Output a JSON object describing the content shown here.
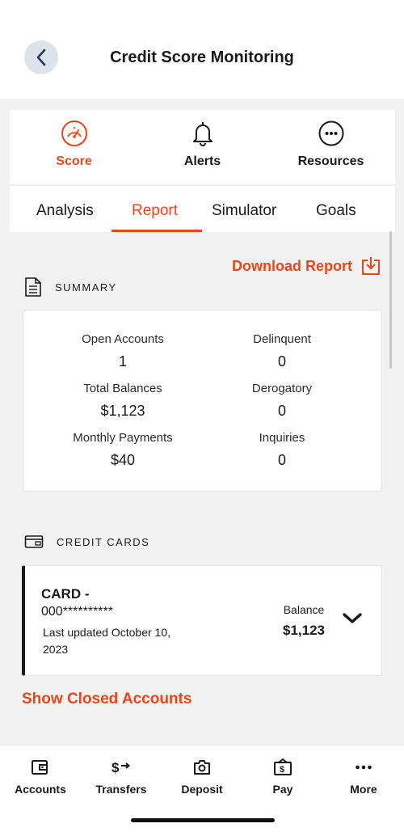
{
  "header": {
    "title": "Credit Score Monitoring",
    "back_icon": "chevron-left-icon"
  },
  "top_tabs": [
    {
      "label": "Score",
      "icon": "speedometer-icon",
      "active": true
    },
    {
      "label": "Alerts",
      "icon": "bell-icon",
      "active": false
    },
    {
      "label": "Resources",
      "icon": "more-circle-icon",
      "active": false
    }
  ],
  "sub_tabs": [
    {
      "label": "Analysis",
      "active": false
    },
    {
      "label": "Report",
      "active": true
    },
    {
      "label": "Simulator",
      "active": false
    },
    {
      "label": "Goals",
      "active": false
    }
  ],
  "download": {
    "label": "Download Report",
    "icon": "download-icon"
  },
  "summary": {
    "heading": "SUMMARY",
    "stats": [
      {
        "label": "Open Accounts",
        "value": "1"
      },
      {
        "label": "Delinquent",
        "value": "0"
      },
      {
        "label": "Total Balances",
        "value": "$1,123"
      },
      {
        "label": "Derogatory",
        "value": "0"
      },
      {
        "label": "Monthly Payments",
        "value": "$40"
      },
      {
        "label": "Inquiries",
        "value": "0"
      }
    ]
  },
  "credit_cards": {
    "heading": "CREDIT CARDS",
    "items": [
      {
        "name": "CARD -",
        "number": "000**********",
        "updated": "Last updated October 10, 2023",
        "balance_label": "Balance",
        "balance": "$1,123"
      }
    ]
  },
  "show_closed": "Show Closed Accounts",
  "bottom_nav": [
    {
      "label": "Accounts",
      "icon": "wallet-icon"
    },
    {
      "label": "Transfers",
      "icon": "transfer-icon"
    },
    {
      "label": "Deposit",
      "icon": "camera-icon"
    },
    {
      "label": "Pay",
      "icon": "bill-icon"
    },
    {
      "label": "More",
      "icon": "ellipsis-icon"
    }
  ],
  "colors": {
    "accent": "#e8471c",
    "text": "#1a1a1a",
    "background": "#f2f2f2",
    "back_button": "#dde3ec"
  }
}
